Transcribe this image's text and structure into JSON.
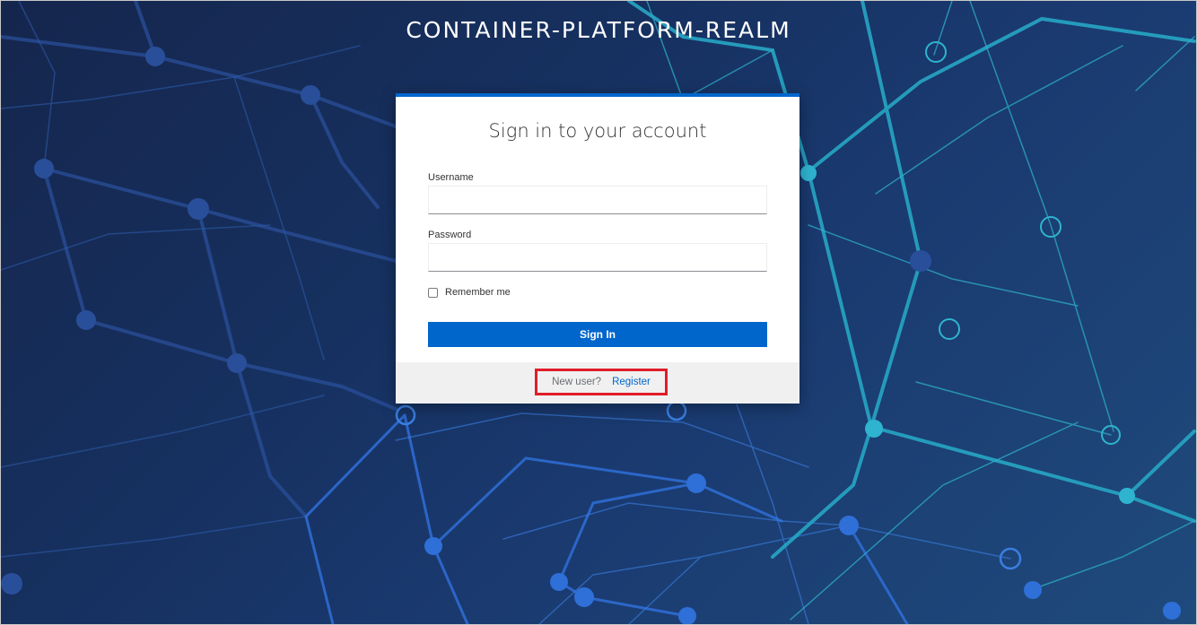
{
  "realm": {
    "title": "CONTAINER-PLATFORM-REALM"
  },
  "login": {
    "heading": "Sign in to your account",
    "username_label": "Username",
    "username_value": "",
    "password_label": "Password",
    "password_value": "",
    "remember_label": "Remember me",
    "remember_checked": false,
    "signin_label": "Sign In"
  },
  "footer": {
    "new_user_text": "New user?",
    "register_label": "Register"
  },
  "colors": {
    "accent": "#0066cc",
    "highlight": "#e11d2a",
    "background_dark": "#15264d"
  }
}
